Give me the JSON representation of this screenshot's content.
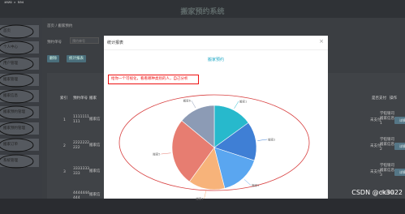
{
  "window": {
    "size_label": "1029 × 504"
  },
  "app": {
    "title": "搬家预约系统"
  },
  "sidebar": {
    "items": [
      {
        "label": "首页"
      },
      {
        "label": "个人中心"
      },
      {
        "label": "用户管理"
      },
      {
        "label": "搬家管理"
      },
      {
        "label": "搬家信息"
      },
      {
        "label": "搬家预约管理"
      },
      {
        "label": "搬家预约管理"
      },
      {
        "label": "搬家订单"
      },
      {
        "label": "系统管理"
      }
    ]
  },
  "breadcrumb": {
    "home": "首页",
    "sep": "/",
    "current": "搬家预约"
  },
  "search": {
    "label": "预约单号",
    "placeholder": "预约单号"
  },
  "toolbar": {
    "delete_label": "删除",
    "stats_label": "统计报表"
  },
  "table": {
    "headers": [
      "索引",
      "预约单号",
      "搬家",
      "是否支付",
      "操作"
    ],
    "rows": [
      {
        "index": "1",
        "order": "1111111",
        "order2": "111",
        "name": "搬家信",
        "paid": "未支付",
        "detail": "学铂银司",
        "detail2": "搬家信息",
        "detail3": "1",
        "op": "详情"
      },
      {
        "index": "2",
        "order": "2222222",
        "order2": "222",
        "name": "搬家信",
        "paid": "未支付",
        "detail": "学铂银司",
        "detail2": "搬家信息",
        "detail3": "2",
        "op": "详情"
      },
      {
        "index": "3",
        "order": "3333333",
        "order2": "333",
        "name": "搬家信",
        "paid": "未支付",
        "detail": "学铂银司",
        "detail2": "搬家信息",
        "detail3": "3",
        "op": "详情"
      },
      {
        "index": "4",
        "order": "4444444",
        "order2": "444",
        "name": "搬家信",
        "paid": "未支付",
        "detail": "学铂银司",
        "detail2": "搬家信息",
        "detail3": "4",
        "op": "详情"
      }
    ]
  },
  "modal": {
    "title": "统计报表",
    "close": "×",
    "chart_title": "搬家预约",
    "note": "给你一个可视化，看看哪种类别的人，自己分析"
  },
  "chart_data": {
    "type": "pie",
    "title": "搬家预约",
    "labels": [
      "搬家1",
      "搬家2",
      "搬家3",
      "搬家4",
      "搬家5",
      "搬家6"
    ],
    "values": [
      15,
      15,
      16,
      14,
      26,
      14
    ],
    "colors": [
      "#27b9cc",
      "#3f7fd5",
      "#5aa6f0",
      "#f7b37a",
      "#e77d71",
      "#8c9bb5"
    ]
  },
  "watermark": "CSDN @ck3022"
}
